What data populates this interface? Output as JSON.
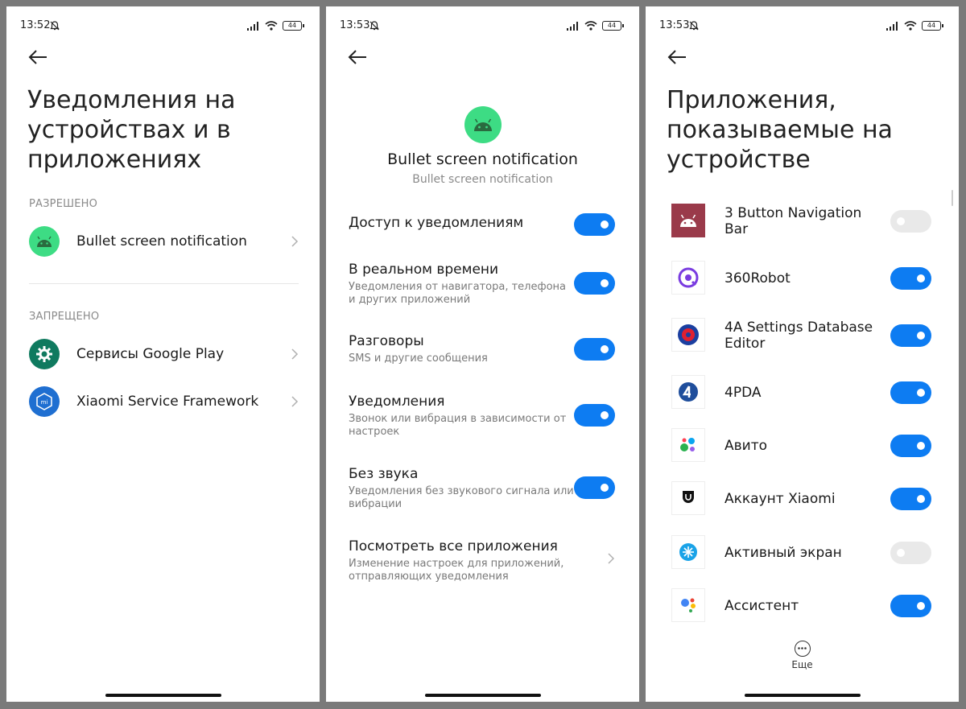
{
  "screen1": {
    "time": "13:52",
    "battery": "44",
    "title": "Уведомления на устройствах и в приложениях",
    "allowed_header": "РАЗРЕШЕНО",
    "allowed_apps": [
      {
        "label": "Bullet screen notification",
        "icon": "android-icon"
      }
    ],
    "denied_header": "ЗАПРЕЩЕНО",
    "denied_apps": [
      {
        "label": "Сервисы Google Play",
        "icon": "google-play-services-icon"
      },
      {
        "label": "Xiaomi Service Framework",
        "icon": "xiaomi-icon"
      }
    ]
  },
  "screen2": {
    "time": "13:53",
    "battery": "44",
    "app_name": "Bullet screen notification",
    "app_sub": "Bullet screen notification",
    "settings": [
      {
        "title": "Доступ к уведомлениям",
        "subtitle": "",
        "enabled": true
      },
      {
        "title": "В реальном времени",
        "subtitle": "Уведомления от навигатора, телефона и других приложений",
        "enabled": true
      },
      {
        "title": "Разговоры",
        "subtitle": "SMS и другие сообщения",
        "enabled": true
      },
      {
        "title": "Уведомления",
        "subtitle": "Звонок или вибрация в зависимости от настроек",
        "enabled": true
      },
      {
        "title": "Без звука",
        "subtitle": "Уведомления без звукового сигнала или вибрации",
        "enabled": true
      }
    ],
    "view_all": {
      "title": "Посмотреть все приложения",
      "subtitle": "Изменение настроек для приложений, отправляющих уведомления"
    }
  },
  "screen3": {
    "time": "13:53",
    "battery": "44",
    "title": "Приложения, показываемые на устройстве",
    "apps": [
      {
        "name": "3 Button Navigation Bar",
        "icon": "android-icon",
        "enabled": false
      },
      {
        "name": "360Robot",
        "icon": "360robot-icon",
        "enabled": true
      },
      {
        "name": "4A Settings Database Editor",
        "icon": "4a-settings-icon",
        "enabled": true
      },
      {
        "name": "4PDA",
        "icon": "4pda-icon",
        "enabled": true
      },
      {
        "name": "Авито",
        "icon": "avito-icon",
        "enabled": true
      },
      {
        "name": "Аккаунт Xiaomi",
        "icon": "xiaomi-account-icon",
        "enabled": true
      },
      {
        "name": "Активный экран",
        "icon": "active-display-icon",
        "enabled": false
      },
      {
        "name": "Ассистент",
        "icon": "google-assistant-icon",
        "enabled": true
      }
    ],
    "more_label": "Еще"
  },
  "colors": {
    "accent": "#0d7cf2",
    "toggle_off": "#e9e9e9",
    "android_green": "#3ddc84"
  }
}
